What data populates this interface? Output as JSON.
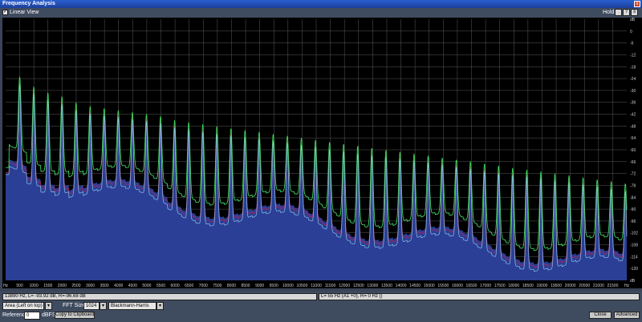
{
  "window": {
    "title": "Frequency Analysis",
    "close_glyph": "x"
  },
  "toolbar": {
    "linear_view_label": "Linear View",
    "hold_label": "Hold"
  },
  "chart_data": {
    "type": "area",
    "x_ticks": [
      "Hz",
      "500",
      "1000",
      "1500",
      "2000",
      "2500",
      "3000",
      "3500",
      "4000",
      "4500",
      "5000",
      "5500",
      "6000",
      "6500",
      "7000",
      "7500",
      "8000",
      "8500",
      "9000",
      "9500",
      "10000",
      "10500",
      "11000",
      "11500",
      "12000",
      "12500",
      "13000",
      "13500",
      "14000",
      "14500",
      "15000",
      "15500",
      "16000",
      "16500",
      "17000",
      "17500",
      "18000",
      "18500",
      "19000",
      "19500",
      "20000",
      "20500",
      "21000",
      "21500",
      "Hz"
    ],
    "y_ticks": [
      "dB",
      "0",
      "-6",
      "-12",
      "-18",
      "-24",
      "-30",
      "-36",
      "-42",
      "-48",
      "-54",
      "-60",
      "-66",
      "-72",
      "-78",
      "-84",
      "-90",
      "-96",
      "-102",
      "-108",
      "-114",
      "-120",
      "dB"
    ],
    "xlim": [
      0,
      22050
    ],
    "ylim": [
      -126,
      6
    ],
    "harmonic_spacing_hz": 500,
    "peaks_db": [
      -26,
      -31,
      -34,
      -36,
      -39,
      -41,
      -42,
      -43,
      -44,
      -45,
      -46,
      -48,
      -49,
      -50,
      -51,
      -52,
      -53,
      -54,
      -55,
      -56,
      -57,
      -58,
      -59,
      -60,
      -61,
      -62,
      -63,
      -64,
      -65,
      -66,
      -67,
      -68,
      -69,
      -70,
      -71,
      -72,
      -73,
      -74,
      -75,
      -76,
      -77,
      -78,
      -79,
      -80
    ],
    "series": [
      {
        "color": "#2b3f96"
      },
      {
        "color": "#c0204a"
      },
      {
        "color": "#3fe060"
      },
      {
        "color": "#8ec8e8"
      }
    ],
    "grid": true,
    "background": "#000000"
  },
  "status": {
    "cursor_readout": "13890 Hz, L= -93.92 dB, R=-96.68 dB",
    "peak_readout": "L=    55 Hz (A1 +0), R=     0 Hz ()"
  },
  "controls": {
    "display_mode": "Area (Left on top)",
    "fft_size_label": "FFT Size",
    "fft_size": "1024",
    "window_fn": "Blackmann-Harris",
    "reference_label": "Reference",
    "reference_value": "0",
    "reference_unit": "dBFS",
    "copy_button": "Copy to Clipboard",
    "close_button": "Close",
    "advanced_button": "Advanced"
  }
}
